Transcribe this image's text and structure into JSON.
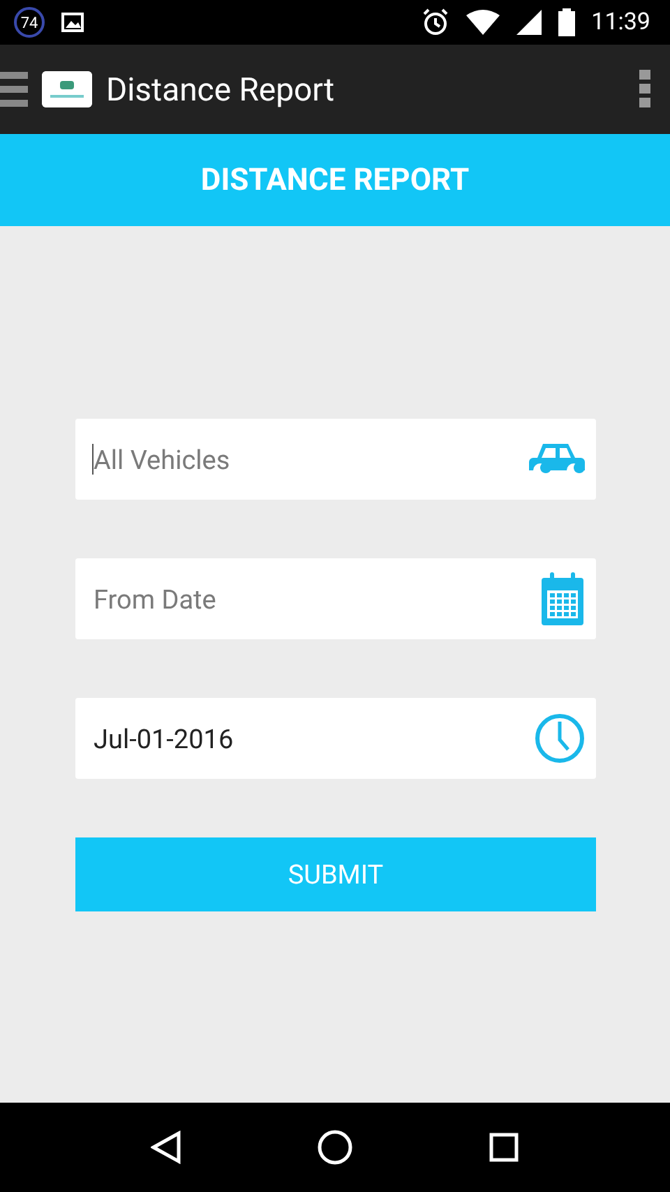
{
  "status_bar": {
    "notification_badge": "74",
    "time": "11:39"
  },
  "app_bar": {
    "title": "Distance Report"
  },
  "header": {
    "title": "DISTANCE REPORT"
  },
  "fields": [
    {
      "kind": "vehicle",
      "placeholder": "All Vehicles",
      "focused": true
    },
    {
      "kind": "date",
      "placeholder": "From Date",
      "focused": false
    },
    {
      "kind": "time",
      "value": "Jul-01-2016",
      "focused": false
    }
  ],
  "submit": {
    "label": "SUBMIT"
  }
}
